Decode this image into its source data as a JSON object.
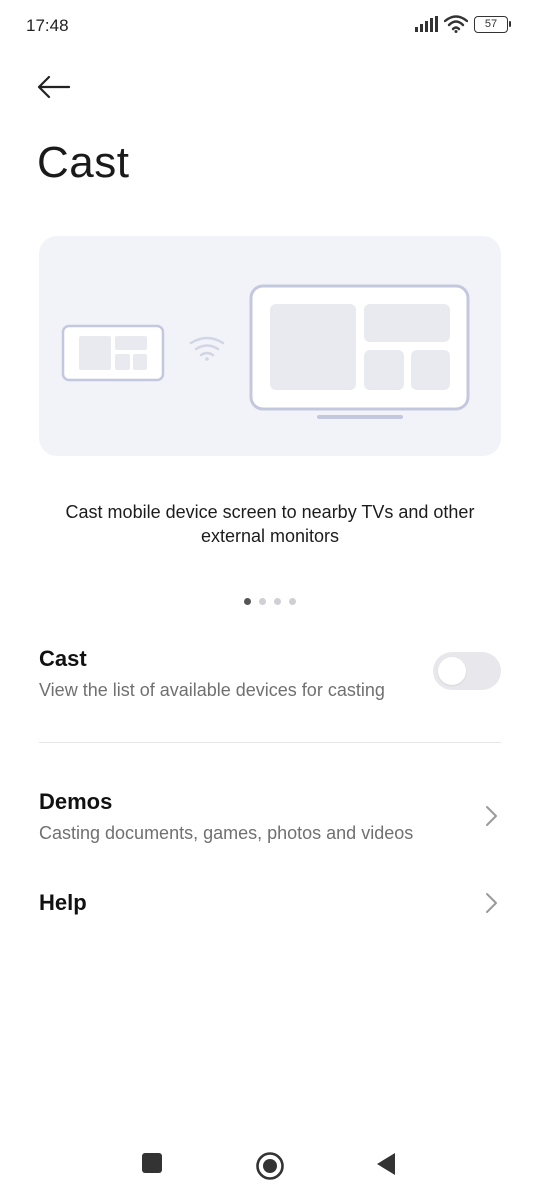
{
  "status_bar": {
    "time": "17:48",
    "battery_level": "57",
    "icons": [
      "signal-icon",
      "wifi-icon",
      "battery-icon"
    ]
  },
  "header": {
    "back_icon": "back-arrow-icon",
    "title": "Cast"
  },
  "hero": {
    "illustration": "phone-to-monitor-cast-illustration",
    "caption": "Cast mobile device screen to nearby TVs and other external monitors",
    "pager": {
      "count": 4,
      "active_index": 0
    }
  },
  "settings": {
    "cast": {
      "title": "Cast",
      "subtitle": "View the list of available devices for casting",
      "toggle_on": false
    },
    "demos": {
      "title": "Demos",
      "subtitle": "Casting documents, games, photos and videos"
    },
    "help": {
      "title": "Help"
    }
  },
  "nav_bar": {
    "buttons": [
      "recents-square-icon",
      "home-circle-icon",
      "back-triangle-icon"
    ]
  },
  "colors": {
    "illustration_stroke": "#c4c8de",
    "illustration_fill": "#e9eaf0",
    "card_background": "#f2f3f8",
    "subtitle_text": "#707070"
  }
}
